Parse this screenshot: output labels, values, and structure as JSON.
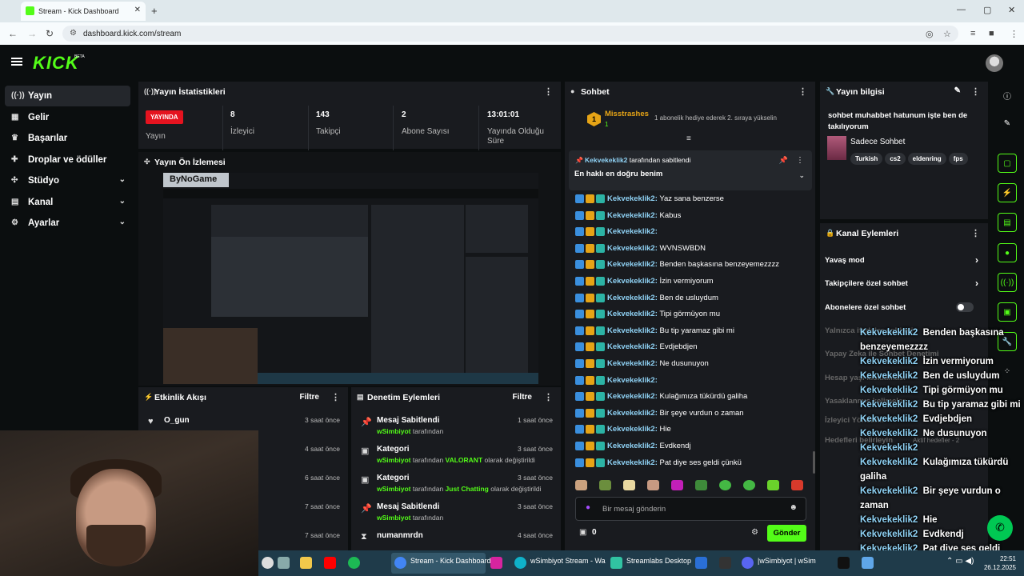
{
  "browser": {
    "tab_title": "Stream - Kick Dashboard",
    "url": "dashboard.kick.com/stream"
  },
  "brand": {
    "logo": "KICK",
    "beta": "BETA",
    "accent": "#53fc18"
  },
  "sidebar": {
    "items": [
      {
        "label": "Yayın",
        "icon": "broadcast-icon"
      },
      {
        "label": "Gelir",
        "icon": "revenue-icon"
      },
      {
        "label": "Başarılar",
        "icon": "trophy-icon"
      },
      {
        "label": "Droplar ve ödüller",
        "icon": "gift-icon"
      },
      {
        "label": "Stüdyo",
        "icon": "studio-icon"
      },
      {
        "label": "Kanal",
        "icon": "channel-icon"
      },
      {
        "label": "Ayarlar",
        "icon": "gear-icon"
      }
    ]
  },
  "stats": {
    "title": "Yayın İstatistikleri",
    "live_badge": "YAYINDA",
    "status_label": "Yayın",
    "viewers": {
      "value": "8",
      "label": "İzleyici"
    },
    "followers": {
      "value": "143",
      "label": "Takipçi"
    },
    "subs": {
      "value": "2",
      "label": "Abone Sayısı"
    },
    "uptime": {
      "value": "13:01:01",
      "label": "Yayında Olduğu Süre"
    }
  },
  "preview": {
    "title": "Yayın Ön İzlemesi",
    "overlay_text": "ByNoGame"
  },
  "activity": {
    "title": "Etkinlik Akışı",
    "filter": "Filtre",
    "rows": [
      {
        "title": "O_gun",
        "time": "3 saat önce"
      },
      {
        "title": "",
        "time": "4 saat önce"
      },
      {
        "title": "",
        "time": "6 saat önce"
      },
      {
        "title": "",
        "time": "7 saat önce"
      },
      {
        "title": "",
        "time": "7 saat önce"
      }
    ]
  },
  "moderation": {
    "title": "Denetim Eylemleri",
    "filter": "Filtre",
    "rows": [
      {
        "title": "Mesaj Sabitlendi",
        "user": "wSimbiyot",
        "pre": "tarafından",
        "highlight": "",
        "post": "",
        "time": "1 saat önce"
      },
      {
        "title": "Kategori",
        "user": "wSimbiyot",
        "pre": "tarafından",
        "highlight": "VALORANT",
        "post": "olarak değiştirildi",
        "time": "3 saat önce"
      },
      {
        "title": "Kategori",
        "user": "wSimbiyot",
        "pre": "tarafından",
        "highlight": "Just Chatting",
        "post": "olarak değiştirildi",
        "time": "3 saat önce"
      },
      {
        "title": "Mesaj Sabitlendi",
        "user": "wSimbiyot",
        "pre": "tarafından",
        "highlight": "",
        "post": "",
        "time": "3 saat önce"
      },
      {
        "title": "numanmrdn",
        "user": "",
        "pre": "",
        "highlight": "",
        "post": "",
        "time": "4 saat önce"
      }
    ]
  },
  "chat": {
    "title": "Sohbet",
    "gift_rank": "1",
    "gift_user": "Misstrashes",
    "gift_count": "1",
    "gift_text": "1 abonelik hediye ederek 2. sıraya yükselin",
    "pinned_by_user": "Kekvekeklik2",
    "pinned_by_text": "tarafından sabitlendi",
    "pinned_message": "En haklı en doğru benim",
    "messages": [
      {
        "user": "Kekvekeklik2:",
        "text": "Yaz sana benzerse"
      },
      {
        "user": "Kekvekeklik2:",
        "text": "Kabus"
      },
      {
        "user": "Kekvekeklik2:",
        "text": ""
      },
      {
        "user": "Kekvekeklik2:",
        "text": "WVNSWBDN"
      },
      {
        "user": "Kekvekeklik2:",
        "text": "Benden başkasına benzeyemezzzz"
      },
      {
        "user": "Kekvekeklik2:",
        "text": "İzin vermiyorum"
      },
      {
        "user": "Kekvekeklik2:",
        "text": "Ben de usluydum"
      },
      {
        "user": "Kekvekeklik2:",
        "text": "Tipi görmüyon mu"
      },
      {
        "user": "Kekvekeklik2:",
        "text": "Bu tip yaramaz gibi mi"
      },
      {
        "user": "Kekvekeklik2:",
        "text": "Evdjebdjen"
      },
      {
        "user": "Kekvekeklik2:",
        "text": "Ne dusunuyon"
      },
      {
        "user": "Kekvekeklik2:",
        "text": ""
      },
      {
        "user": "Kekvekeklik2:",
        "text": "Kulağımıza tükürdü galiha"
      },
      {
        "user": "Kekvekeklik2:",
        "text": "Bir şeye vurdun o zaman"
      },
      {
        "user": "Kekvekeklik2:",
        "text": "Hie"
      },
      {
        "user": "Kekvekeklik2:",
        "text": "Evdkendj"
      },
      {
        "user": "Kekvekeklik2:",
        "text": "Pat diye ses geldi çünkü"
      }
    ],
    "input_placeholder": "Bir mesaj gönderin",
    "points": "0",
    "send_label": "Gönder"
  },
  "stream_info": {
    "title": "Yayın bilgisi",
    "stream_title": "sohbet muhabbet hatunum işte ben de takılıyorum",
    "category": "Sadece Sohbet",
    "tags": [
      "Turkish",
      "cs2",
      "eldenring",
      "fps"
    ]
  },
  "channel_actions": {
    "title": "Kanal Eylemleri",
    "rows": [
      {
        "label": "Yavaş mod",
        "control": "arrow"
      },
      {
        "label": "Takipçilere özel sohbet",
        "control": "arrow"
      },
      {
        "label": "Abonelere özel sohbet",
        "control": "toggle"
      },
      {
        "label": "Yalnızca ifadeler sohbeti",
        "control": "toggle"
      },
      {
        "label": "Yapay Zeka ile Sohbet Denetimi",
        "control": "none"
      },
      {
        "label": "Hesap yaşı kısıtlaması",
        "control": "none"
      },
      {
        "label": "Yasaklanmış kelimeler",
        "control": "arrow"
      },
      {
        "label": "İzleyici Yönetimi",
        "control": "none"
      },
      {
        "label": "Hedefleri belirleyin",
        "control": "arrow"
      }
    ],
    "goals_status": "Aktif hedefler - 2"
  },
  "overlay_chat": [
    {
      "user": "Kekvekeklik2",
      "text": "Benden başkasına benzeyemezzzz"
    },
    {
      "user": "Kekvekeklik2",
      "text": "İzin vermiyorum"
    },
    {
      "user": "Kekvekeklik2",
      "text": "Ben de usluydum"
    },
    {
      "user": "Kekvekeklik2",
      "text": "Tipi görmüyon mu"
    },
    {
      "user": "Kekvekeklik2",
      "text": "Bu tip yaramaz gibi mi"
    },
    {
      "user": "Kekvekeklik2",
      "text": "Evdjebdjen"
    },
    {
      "user": "Kekvekeklik2",
      "text": "Ne dusunuyon"
    },
    {
      "user": "Kekvekeklik2",
      "text": ""
    },
    {
      "user": "Kekvekeklik2",
      "text": "Kulağımıza tükürdü galiha"
    },
    {
      "user": "Kekvekeklik2",
      "text": "Bir şeye vurdun o zaman"
    },
    {
      "user": "Kekvekeklik2",
      "text": "Hie"
    },
    {
      "user": "Kekvekeklik2",
      "text": "Evdkendj"
    },
    {
      "user": "Kekvekeklik2",
      "text": "Pat diye ses geldi çünkü"
    }
  ],
  "taskbar": {
    "apps": [
      {
        "label": "Stream - Kick Dashboard"
      },
      {
        "label": "wSimbiyot Stream - Wa"
      },
      {
        "label": "Streamlabs Desktop"
      },
      {
        "label": "|wSimbiyot | wSim"
      }
    ],
    "time": "22:51",
    "date": "26.12.2025"
  }
}
